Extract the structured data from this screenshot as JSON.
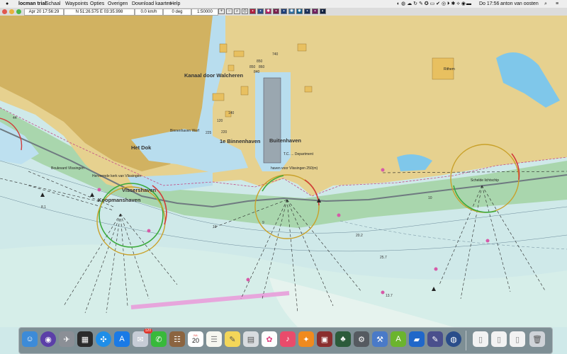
{
  "menubar": {
    "app_name": "locman trial",
    "items": [
      "Schaal",
      "Waypoints",
      "Opties",
      "Overigen",
      "Download kaarten",
      "Help"
    ],
    "clock": "Do 17:56",
    "user": "anton van oosten"
  },
  "toolbar": {
    "datetime": "Apr 20 17:56:29",
    "position": "N 51:26.575 E 03:35.998",
    "speed": "0.0  km/h",
    "heading": "0 deg",
    "scale": "1:50000"
  },
  "map_labels": {
    "kanaal": "Kanaal door Walcheren",
    "binnenhaven": "1e Binnenhaven",
    "buitenhaven": "Buitenhaven",
    "het_dok": "Het Dok",
    "vissershaven": "Vissershaven",
    "koopmanshaven": "Koopmanshaven",
    "rithem": "Rithem",
    "binnenhaven_werf": "Binnenhaven Werf",
    "tc_department": "T.C. ... Department",
    "boulevard": "Boulevard Vlissingen",
    "hervormde": "Hervormde kerk van Vlissingen",
    "haven": "haven voor Vlissingen 250(m)",
    "schelde": "Schelde lichtschip"
  },
  "depths": [
    "740",
    "850",
    "860",
    "850",
    "840",
    "220",
    "225",
    "140",
    "120",
    "44",
    "10",
    "25.7",
    "20.2",
    "13.7",
    "8.1",
    "10",
    "9"
  ],
  "dock": {
    "calendar_month": "JUL",
    "calendar_day": "20",
    "mail_badge": "120"
  }
}
